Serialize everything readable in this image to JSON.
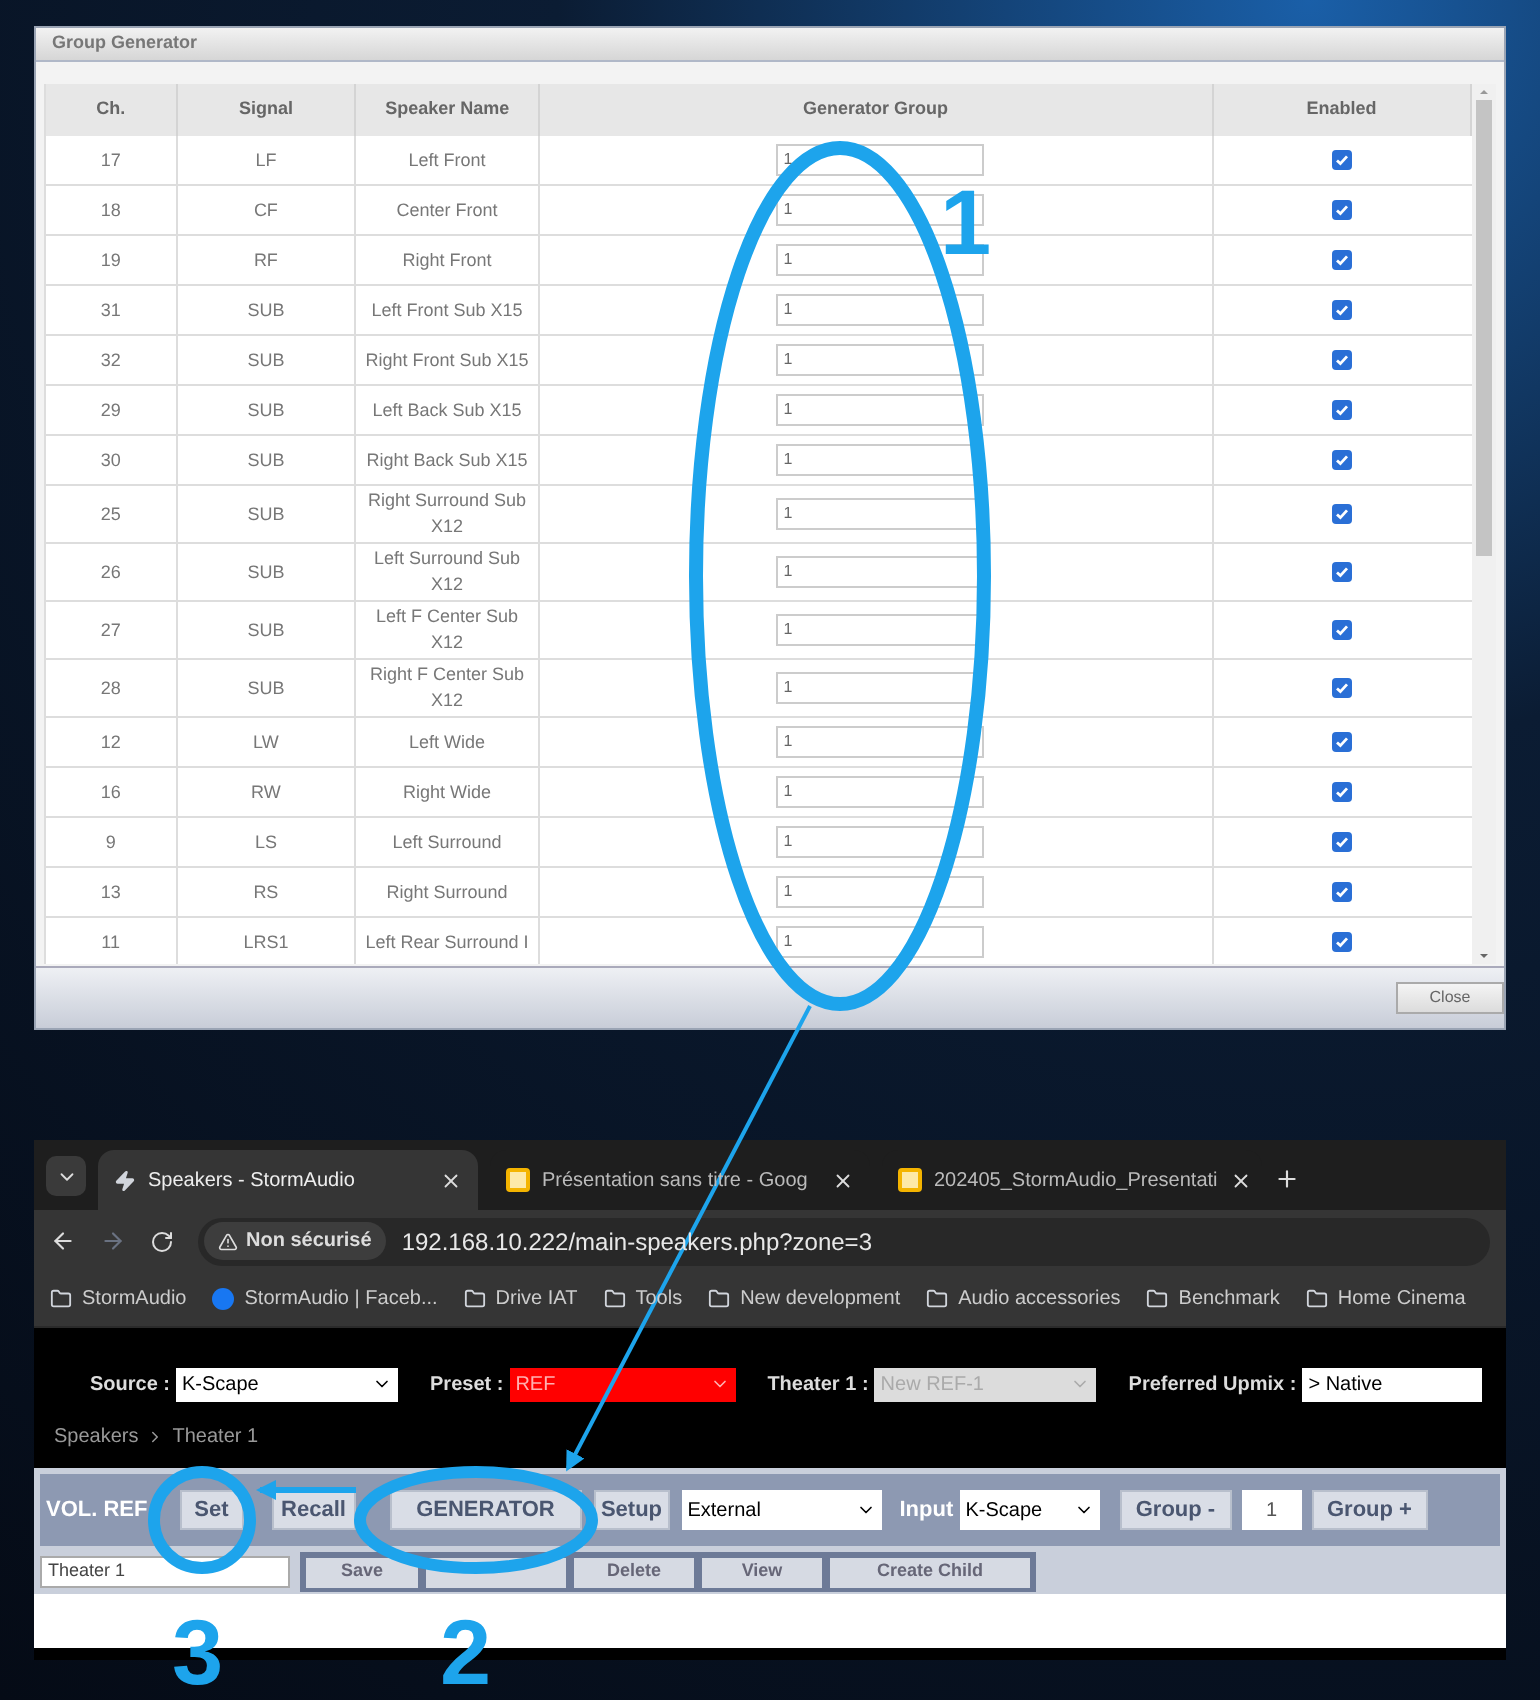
{
  "dialog": {
    "title": "Group Generator",
    "columns": [
      "Ch.",
      "Signal",
      "Speaker Name",
      "Generator Group",
      "Enabled"
    ],
    "rows": [
      {
        "ch": "17",
        "signal": "LF",
        "speaker_name": "Left Front",
        "generator_group": "1",
        "enabled": true
      },
      {
        "ch": "18",
        "signal": "CF",
        "speaker_name": "Center Front",
        "generator_group": "1",
        "enabled": true
      },
      {
        "ch": "19",
        "signal": "RF",
        "speaker_name": "Right Front",
        "generator_group": "1",
        "enabled": true
      },
      {
        "ch": "31",
        "signal": "SUB",
        "speaker_name": "Left Front Sub X15",
        "generator_group": "1",
        "enabled": true
      },
      {
        "ch": "32",
        "signal": "SUB",
        "speaker_name": "Right Front Sub X15",
        "generator_group": "1",
        "enabled": true
      },
      {
        "ch": "29",
        "signal": "SUB",
        "speaker_name": "Left Back Sub X15",
        "generator_group": "1",
        "enabled": true
      },
      {
        "ch": "30",
        "signal": "SUB",
        "speaker_name": "Right Back Sub X15",
        "generator_group": "1",
        "enabled": true
      },
      {
        "ch": "25",
        "signal": "SUB",
        "speaker_name": "Right Surround Sub X12",
        "generator_group": "1",
        "enabled": true
      },
      {
        "ch": "26",
        "signal": "SUB",
        "speaker_name": "Left Surround Sub X12",
        "generator_group": "1",
        "enabled": true
      },
      {
        "ch": "27",
        "signal": "SUB",
        "speaker_name": "Left F Center Sub X12",
        "generator_group": "1",
        "enabled": true
      },
      {
        "ch": "28",
        "signal": "SUB",
        "speaker_name": "Right F Center Sub X12",
        "generator_group": "1",
        "enabled": true
      },
      {
        "ch": "12",
        "signal": "LW",
        "speaker_name": "Left Wide",
        "generator_group": "1",
        "enabled": true
      },
      {
        "ch": "16",
        "signal": "RW",
        "speaker_name": "Right Wide",
        "generator_group": "1",
        "enabled": true
      },
      {
        "ch": "9",
        "signal": "LS",
        "speaker_name": "Left Surround",
        "generator_group": "1",
        "enabled": true
      },
      {
        "ch": "13",
        "signal": "RS",
        "speaker_name": "Right Surround",
        "generator_group": "1",
        "enabled": true
      },
      {
        "ch": "11",
        "signal": "LRS1",
        "speaker_name": "Left Rear Surround I",
        "generator_group": "1",
        "enabled": true
      }
    ],
    "close_button": "Close"
  },
  "browser": {
    "tabs": [
      {
        "title": "Speakers - StormAudio",
        "kind": "bolt",
        "selected": true
      },
      {
        "title": "Présentation sans titre - Goog",
        "kind": "slides",
        "selected": false
      },
      {
        "title": "202405_StormAudio_Presentati",
        "kind": "slides",
        "selected": false
      }
    ],
    "security_label": "Non sécurisé",
    "url": "192.168.10.222/main-speakers.php?zone=3",
    "bookmarks": [
      {
        "label": "StormAudio",
        "kind": "folder"
      },
      {
        "label": "StormAudio | Faceb...",
        "kind": "facebook"
      },
      {
        "label": "Drive IAT",
        "kind": "folder"
      },
      {
        "label": "Tools",
        "kind": "folder"
      },
      {
        "label": "New development",
        "kind": "folder"
      },
      {
        "label": "Audio accessories",
        "kind": "folder"
      },
      {
        "label": "Benchmark",
        "kind": "folder"
      },
      {
        "label": "Home Cinema",
        "kind": "folder"
      }
    ]
  },
  "page": {
    "selectors": [
      {
        "label": "Source :",
        "value": "K-Scape",
        "kind": "select"
      },
      {
        "label": "Preset :",
        "value": "REF",
        "kind": "alert"
      },
      {
        "label": "Theater 1 :",
        "value": "New REF-1",
        "kind": "disabled"
      },
      {
        "label": "Preferred Upmix :",
        "value": "> Native",
        "kind": "field"
      }
    ],
    "breadcrumb": [
      "Speakers",
      "Theater 1"
    ],
    "toolbar": {
      "label": "VOL. REF",
      "items": [
        {
          "kind": "button",
          "text": "Set"
        },
        {
          "kind": "button",
          "text": "Recall"
        },
        {
          "kind": "button",
          "text": "GENERATOR"
        },
        {
          "kind": "button",
          "text": "Setup"
        },
        {
          "kind": "select",
          "text": "External"
        },
        {
          "kind": "label",
          "text": "Input"
        },
        {
          "kind": "select",
          "text": "K-Scape"
        },
        {
          "kind": "button",
          "text": "Group -"
        },
        {
          "kind": "field",
          "text": "1"
        },
        {
          "kind": "button",
          "text": "Group +"
        }
      ]
    },
    "preset_name": "Theater 1",
    "preset_buttons": [
      {
        "kind": "button",
        "text": "Save"
      },
      {
        "kind": "covered"
      },
      {
        "kind": "button",
        "text": "Delete"
      },
      {
        "kind": "button",
        "text": "View"
      },
      {
        "kind": "button",
        "text": "Create Child"
      }
    ]
  },
  "annotations": [
    "1",
    "2",
    "3"
  ]
}
